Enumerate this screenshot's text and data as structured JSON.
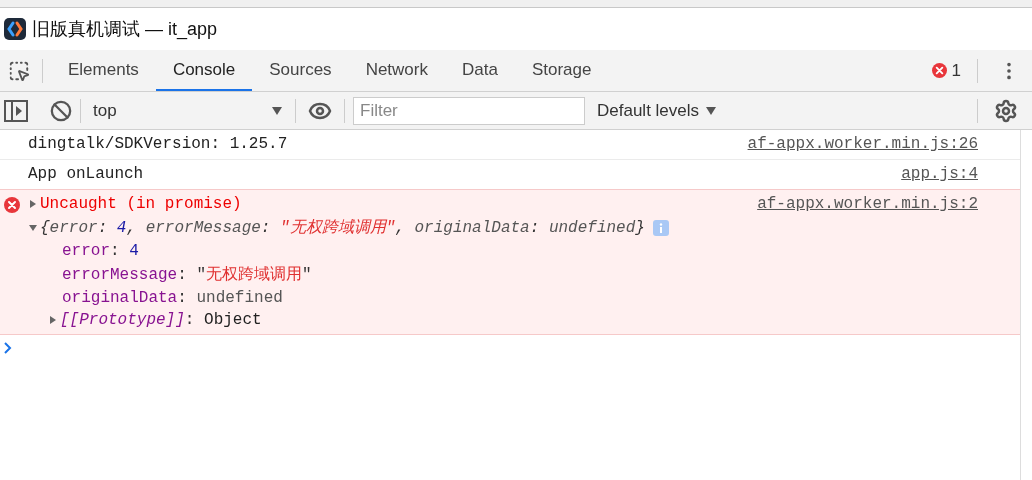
{
  "window": {
    "title": "旧版真机调试 — it_app"
  },
  "tabs": [
    {
      "label": "Elements",
      "selected": false
    },
    {
      "label": "Console",
      "selected": true
    },
    {
      "label": "Sources",
      "selected": false
    },
    {
      "label": "Network",
      "selected": false
    },
    {
      "label": "Data",
      "selected": false
    },
    {
      "label": "Storage",
      "selected": false
    }
  ],
  "error_count": "1",
  "toolbar": {
    "context": "top",
    "filter": {
      "placeholder": "Filter"
    },
    "levels": "Default levels"
  },
  "messages": [
    {
      "kind": "log",
      "text": "dingtalk/SDKVersion: 1.25.7",
      "source": "af-appx.worker.min.js:26"
    },
    {
      "kind": "log",
      "text": "App onLaunch",
      "source": "app.js:4"
    },
    {
      "kind": "error",
      "text": "Uncaught (in promise)",
      "expanded": false,
      "source": "af-appx.worker.min.js:2",
      "object": {
        "expanded": true,
        "preview": [
          {
            "text": "{",
            "kind": "punct"
          },
          {
            "text": "error",
            "kind": "key"
          },
          {
            "text": ": ",
            "kind": "punct"
          },
          {
            "text": "4",
            "kind": "number"
          },
          {
            "text": ", ",
            "kind": "punct"
          },
          {
            "text": "errorMessage",
            "kind": "key"
          },
          {
            "text": ": ",
            "kind": "punct"
          },
          {
            "text": "\"无权跨域调用\"",
            "kind": "string"
          },
          {
            "text": ", ",
            "kind": "punct"
          },
          {
            "text": "originalData",
            "kind": "key"
          },
          {
            "text": ": ",
            "kind": "punct"
          },
          {
            "text": "undefined",
            "kind": "undefined"
          },
          {
            "text": "}",
            "kind": "punct"
          }
        ],
        "properties": [
          [
            {
              "text": "error",
              "kind": "prop"
            },
            {
              "text": ": ",
              "kind": "punct"
            },
            {
              "text": "4",
              "kind": "number"
            }
          ],
          [
            {
              "text": "errorMessage",
              "kind": "prop"
            },
            {
              "text": ": \"",
              "kind": "punct"
            },
            {
              "text": "无权跨域调用",
              "kind": "string"
            },
            {
              "text": "\"",
              "kind": "punct"
            }
          ],
          [
            {
              "text": "originalData",
              "kind": "prop"
            },
            {
              "text": ": ",
              "kind": "punct"
            },
            {
              "text": "undefined",
              "kind": "undefined"
            }
          ]
        ],
        "prototype": {
          "expanded": false,
          "line": [
            {
              "text": "[[Prototype]]",
              "kind": "proto"
            },
            {
              "text": ": ",
              "kind": "punct"
            },
            {
              "text": "Object",
              "kind": "plain"
            }
          ]
        }
      }
    }
  ]
}
